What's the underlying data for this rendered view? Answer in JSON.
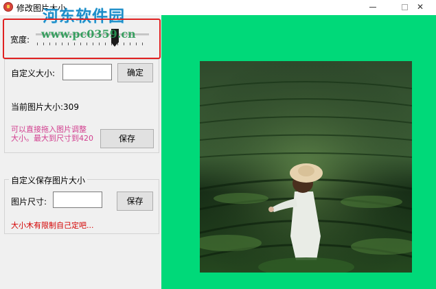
{
  "window": {
    "title": "修改图片大小",
    "controls": {
      "minimize": "–",
      "maximize": "☐",
      "close": "✕"
    }
  },
  "watermark": {
    "site_name": "河东软件园",
    "url": "www.pc0359.cn"
  },
  "slider": {
    "label": "宽度:",
    "value_fraction": 0.71
  },
  "custom_size": {
    "label": "自定义大小:",
    "value": "",
    "confirm_label": "确定"
  },
  "current_size": {
    "text": "当前图片大小:309"
  },
  "hint": {
    "text": "可以直接拖入图片调整大小。最大到尺寸到420"
  },
  "save_button": {
    "label": "保存"
  },
  "save_group": {
    "title": "自定义保存图片大小",
    "size_label": "图片尺寸:",
    "size_value": "",
    "save_label": "保存",
    "notice": "大小木有限制自己定吧..."
  },
  "colors": {
    "preview_background": "#00d979",
    "highlight": "#e02020",
    "hint_text": "#d23f8f",
    "notice_text": "#d40000"
  },
  "preview": {
    "image_subject": "woman-in-tea-field"
  }
}
